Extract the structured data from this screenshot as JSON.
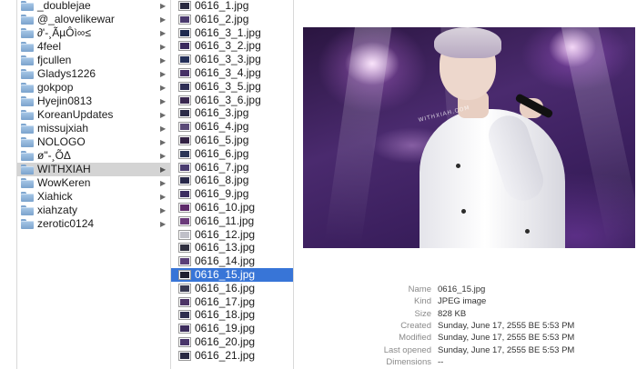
{
  "folders": [
    {
      "label": "_doublejae"
    },
    {
      "label": "@_alovelikewar"
    },
    {
      "label": "∂'-¸ÃµÔì∞≤"
    },
    {
      "label": "4feel"
    },
    {
      "label": "fjcullen"
    },
    {
      "label": "Gladys1226"
    },
    {
      "label": "gokpop"
    },
    {
      "label": "Hyejin0813"
    },
    {
      "label": "KoreanUpdates"
    },
    {
      "label": "missujxiah"
    },
    {
      "label": "NOLOGO"
    },
    {
      "label": "ø\"-¸ÕΔ"
    },
    {
      "label": "WITHXIAH",
      "selected": true
    },
    {
      "label": "WowKeren"
    },
    {
      "label": "Xiahick"
    },
    {
      "label": "xiahzaty"
    },
    {
      "label": "zerotic0124"
    }
  ],
  "files": [
    {
      "label": "0616_1.jpg"
    },
    {
      "label": "0616_2.jpg"
    },
    {
      "label": "0616_3_1.jpg"
    },
    {
      "label": "0616_3_2.jpg"
    },
    {
      "label": "0616_3_3.jpg"
    },
    {
      "label": "0616_3_4.jpg"
    },
    {
      "label": "0616_3_5.jpg"
    },
    {
      "label": "0616_3_6.jpg"
    },
    {
      "label": "0616_3.jpg"
    },
    {
      "label": "0616_4.jpg"
    },
    {
      "label": "0616_5.jpg"
    },
    {
      "label": "0616_6.jpg"
    },
    {
      "label": "0616_7.jpg"
    },
    {
      "label": "0616_8.jpg"
    },
    {
      "label": "0616_9.jpg"
    },
    {
      "label": "0616_10.jpg"
    },
    {
      "label": "0616_11.jpg"
    },
    {
      "label": "0616_12.jpg"
    },
    {
      "label": "0616_13.jpg"
    },
    {
      "label": "0616_14.jpg"
    },
    {
      "label": "0616_15.jpg",
      "selected": true
    },
    {
      "label": "0616_16.jpg"
    },
    {
      "label": "0616_17.jpg"
    },
    {
      "label": "0616_18.jpg"
    },
    {
      "label": "0616_19.jpg"
    },
    {
      "label": "0616_20.jpg"
    },
    {
      "label": "0616_21.jpg"
    }
  ],
  "thumb_colors": [
    "#2a2a40",
    "#4b3a6e",
    "#1e2a50",
    "#3b2a5e",
    "#25315a",
    "#453066",
    "#2d2d55",
    "#3a2850",
    "#2a2a48",
    "#5a4a78",
    "#332244",
    "#2c3658",
    "#4a3c70",
    "#28284a",
    "#3d2e62",
    "#5e2a6a",
    "#6a3a7a",
    "#c0c0c8",
    "#303040",
    "#5a3f78",
    "#202030",
    "#3a3a52",
    "#4c3466",
    "#2f2f50",
    "#3c2c5c",
    "#48356a",
    "#2a2a44"
  ],
  "preview": {
    "watermark": "WITHXIAH.COM"
  },
  "info": [
    {
      "key": "Name",
      "value": "0616_15.jpg"
    },
    {
      "key": "Kind",
      "value": "JPEG image"
    },
    {
      "key": "Size",
      "value": "828 KB"
    },
    {
      "key": "Created",
      "value": "Sunday, June 17, 2555 BE 5:53 PM"
    },
    {
      "key": "Modified",
      "value": "Sunday, June 17, 2555 BE 5:53 PM"
    },
    {
      "key": "Last opened",
      "value": "Sunday, June 17, 2555 BE 5:53 PM"
    },
    {
      "key": "Dimensions",
      "value": "--"
    }
  ],
  "colors": {
    "selection_blue": "#3875d7",
    "selection_gray": "#d4d4d4",
    "folder_blue": "#8fb4da"
  },
  "icons": {
    "folder": "folder-icon",
    "disclosure": "chevron-right-icon",
    "file": "jpeg-thumbnail-icon"
  }
}
